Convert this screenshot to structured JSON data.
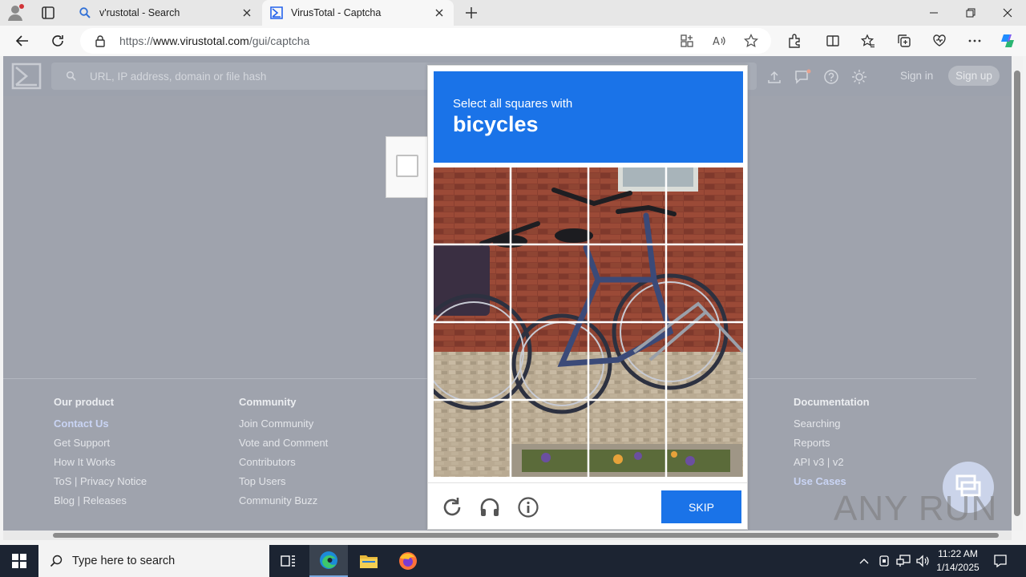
{
  "browser": {
    "tabs": [
      {
        "title": "v'rustotal - Search",
        "active": false
      },
      {
        "title": "VirusTotal - Captcha",
        "active": true
      }
    ],
    "url_prefix": "https://",
    "url_domain": "www.virustotal.com",
    "url_path": "/gui/captcha"
  },
  "vt": {
    "search_placeholder": "URL, IP address, domain or file hash",
    "sign_in": "Sign in",
    "sign_up": "Sign up"
  },
  "footer": {
    "col1": {
      "heading": "Our product",
      "items": [
        "Contact Us",
        "Get Support",
        "How It Works",
        "ToS | Privacy Notice",
        "Blog | Releases"
      ]
    },
    "col2": {
      "heading": "Community",
      "items": [
        "Join Community",
        "Vote and Comment",
        "Contributors",
        "Top Users",
        "Community Buzz"
      ]
    },
    "col3": {
      "heading": "Documentation",
      "items": [
        "Searching",
        "Reports",
        "API v3 | v2",
        "Use Cases"
      ]
    }
  },
  "captcha": {
    "prompt": "Select all squares with",
    "object": "bicycles",
    "skip_label": "SKIP"
  },
  "watermark": "ANY RUN",
  "taskbar": {
    "search_placeholder": "Type here to search",
    "time": "11:22 AM",
    "date": "1/14/2025"
  },
  "colors": {
    "captcha_blue": "#1a73e8",
    "taskbar": "#1c2432"
  }
}
